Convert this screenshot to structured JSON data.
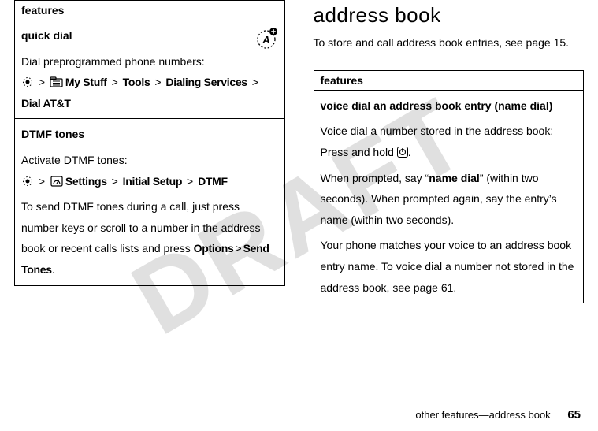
{
  "watermark": "DRAFT",
  "left": {
    "header": "features",
    "rows": [
      {
        "title": "quick dial",
        "line1": "Dial preprogrammed phone numbers:",
        "path_parts": [
          "My Stuff",
          "Tools",
          "Dialing Services",
          "Dial AT&T"
        ]
      },
      {
        "title": "DTMF tones",
        "line1": "Activate DTMF tones:",
        "path_parts": [
          "Settings",
          "Initial Setup",
          "DTMF"
        ],
        "line2_a": "To send DTMF tones during a call, just press number keys or scroll to a number in the address book or recent calls lists and press ",
        "line2_b": "Options",
        "line2_c": "Send Tones",
        "line2_d": "."
      }
    ]
  },
  "right": {
    "heading": "address book",
    "intro": "To store and call address book entries, see page 15.",
    "header": "features",
    "row": {
      "title": "voice dial an address book entry (name dial)",
      "line1": "Voice dial a number stored in the address book:",
      "line2_a": "Press and hold ",
      "line2_b": ".",
      "line3_a": "When prompted, say “",
      "line3_b": "name dial",
      "line3_c": "” (within two seconds). When prompted again, say the entry’s name (within two seconds).",
      "line4": "Your phone matches your voice to an address book entry name. To voice dial a number not stored in the address book, see page 61."
    }
  },
  "footer": {
    "text": "other features—address book",
    "page": "65"
  }
}
